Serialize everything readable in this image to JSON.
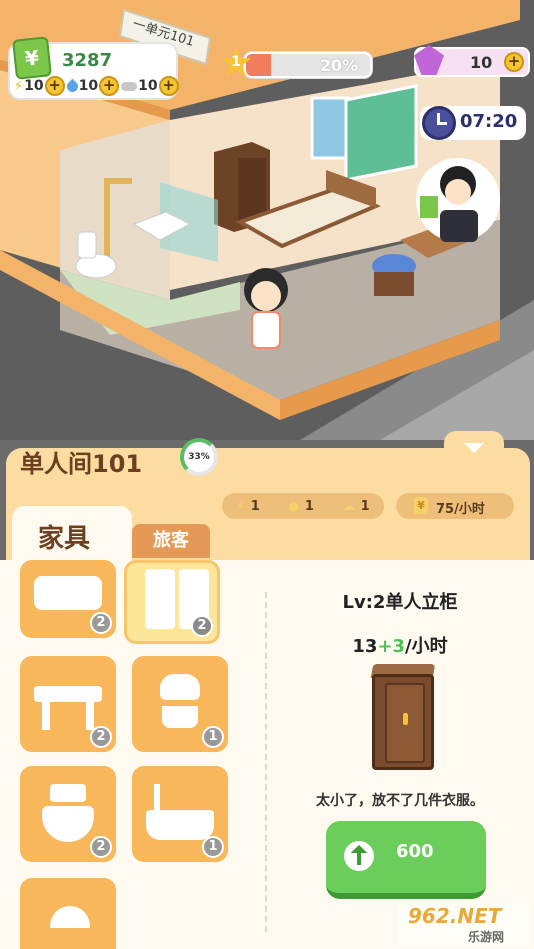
{
  "hud": {
    "money": "3287",
    "resources": [
      {
        "icon": "bolt-icon",
        "value": "10"
      },
      {
        "icon": "water-drop-icon",
        "value": "10"
      },
      {
        "icon": "cloud-icon",
        "value": "10"
      }
    ],
    "star_level": "1",
    "star_progress_label": "20%",
    "star_progress": 0.2,
    "gems": "10",
    "timer": "07:20",
    "room_sign": "一单元101",
    "plus": "+",
    "yen": "¥"
  },
  "panel": {
    "room_title": "单人间101",
    "room_progress": "33%",
    "stats": [
      {
        "icon": "bolt-icon",
        "value": "1"
      },
      {
        "icon": "water-drop-icon",
        "value": "1"
      },
      {
        "icon": "cloud-icon",
        "value": "1"
      }
    ],
    "rate": "75/小时",
    "tabs": [
      {
        "label": "家具",
        "active": true
      },
      {
        "label": "旅客",
        "active": false
      }
    ],
    "furniture": [
      {
        "name": "bed",
        "icon": "bed-icon",
        "level": "2",
        "selected": false
      },
      {
        "name": "wardrobe",
        "icon": "wardrobe-icon",
        "level": "2",
        "selected": true
      },
      {
        "name": "table",
        "icon": "table-icon",
        "level": "2",
        "selected": false
      },
      {
        "name": "plant",
        "icon": "plant-icon",
        "level": "1",
        "selected": false
      },
      {
        "name": "toilet",
        "icon": "toilet-icon",
        "level": "2",
        "selected": false
      },
      {
        "name": "bathtub",
        "icon": "bathtub-icon",
        "level": "1",
        "selected": false
      },
      {
        "name": "shower",
        "icon": "shower-icon",
        "level": "",
        "selected": false
      }
    ],
    "detail": {
      "title": "Lv:2单人立柜",
      "rate_base": "13",
      "rate_bonus": "+3",
      "rate_unit": "/小时",
      "description": "太小了，放不了几件衣服。",
      "upgrade_cost": "600"
    }
  },
  "watermark": {
    "big": "962.NET",
    "small": "乐游网"
  },
  "colors": {
    "panel_bg": "#fcdca0",
    "card": "#f7b75a",
    "upgrade": "#6cce5a",
    "money": "#3a8a45",
    "gem": "#c066d8"
  }
}
